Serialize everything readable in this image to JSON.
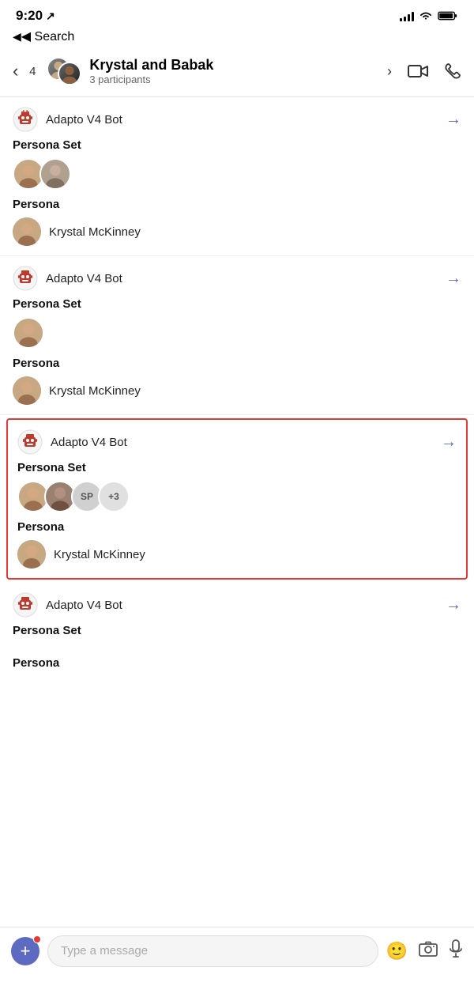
{
  "statusBar": {
    "time": "9:20",
    "locationIcon": "↗",
    "signalBars": [
      3,
      5,
      7,
      9
    ],
    "wifiIcon": "wifi",
    "batteryIcon": "battery"
  },
  "nav": {
    "backLabel": "◀ Search",
    "backCount": "4"
  },
  "header": {
    "chatName": "Krystal and Babak",
    "participants": "3 participants",
    "chevron": "›"
  },
  "messages": [
    {
      "id": "msg1",
      "sender": "Adapto V4 Bot",
      "highlighted": false,
      "personaSetLabel": "Persona Set",
      "personaSetAvatars": [
        "f",
        "f2"
      ],
      "personaLabel": "Persona",
      "personaName": "Krystal McKinney",
      "personaGender": "f"
    },
    {
      "id": "msg2",
      "sender": "Adapto V4 Bot",
      "highlighted": false,
      "personaSetLabel": "Persona Set",
      "personaSetAvatars": [
        "f"
      ],
      "personaLabel": "Persona",
      "personaName": "Krystal McKinney",
      "personaGender": "f"
    },
    {
      "id": "msg3",
      "sender": "Adapto V4 Bot",
      "highlighted": true,
      "personaSetLabel": "Persona Set",
      "personaSetAvatars": [
        "f",
        "m",
        "SP",
        "+3"
      ],
      "personaLabel": "Persona",
      "personaName": "Krystal McKinney",
      "personaGender": "f"
    },
    {
      "id": "msg4",
      "sender": "Adapto V4 Bot",
      "highlighted": false,
      "personaSetLabel": "Persona Set",
      "personaSetAvatars": [],
      "personaLabel": "Persona",
      "personaName": "",
      "personaGender": ""
    }
  ],
  "bottomBar": {
    "placeholder": "Type a message",
    "addIcon": "+",
    "emojiIcon": "🙂",
    "cameraIcon": "📷",
    "micIcon": "🎤"
  }
}
